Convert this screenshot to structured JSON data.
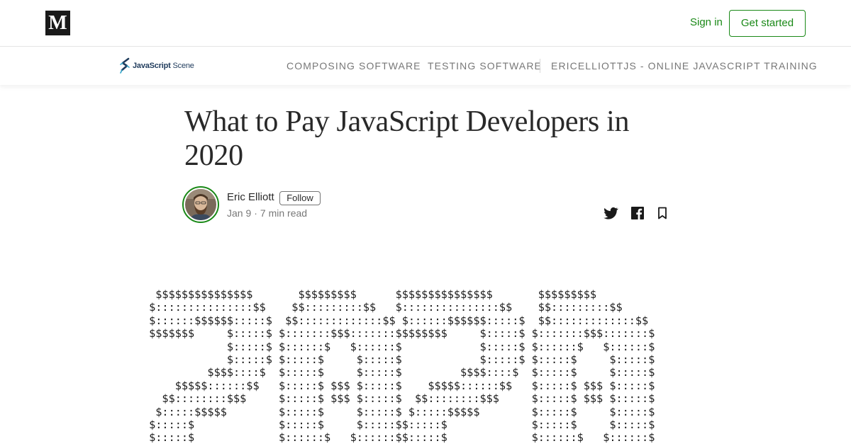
{
  "topbar": {
    "logo_letter": "M",
    "signin_label": "Sign in",
    "get_started_label": "Get started"
  },
  "publication": {
    "logo_word_bold": "JavaScript",
    "logo_word_light": "Scene",
    "nav": [
      "COMPOSING SOFTWARE",
      "TESTING SOFTWARE",
      "ERICELLIOTTJS - ONLINE JAVASCRIPT TRAINING"
    ]
  },
  "article": {
    "title_line1": "What to Pay JavaScript Developers in",
    "title_line2": "2020",
    "author_name": "Eric Elliott",
    "follow_label": "Follow",
    "date": "Jan 9",
    "read_time": "7 min read",
    "ascii_art": "  $$$$$$$$$$$$$$$       $$$$$$$$$      $$$$$$$$$$$$$$$       $$$$$$$$$\n $:::::::::::::::$$    $$:::::::::$$   $:::::::::::::::$$    $$:::::::::$$\n $::::::$$$$$$:::::$  $$:::::::::::::$$ $::::::$$$$$$:::::$  $$:::::::::::::$$\n $$$$$$$     $:::::$ $:::::::$$$:::::::$$$$$$$$     $:::::$ $:::::::$$$:::::::$\n             $:::::$ $::::::$   $::::::$            $:::::$ $::::::$   $::::::$\n             $:::::$ $:::::$     $:::::$            $:::::$ $:::::$     $:::::$\n          $$$$::::$  $:::::$     $:::::$         $$$$::::$  $:::::$     $:::::$\n     $$$$$::::::$$   $:::::$ $$$ $:::::$    $$$$$::::::$$   $:::::$ $$$ $:::::$\n   $$::::::::$$$     $:::::$ $$$ $:::::$  $$::::::::$$$     $:::::$ $$$ $:::::$\n  $:::::$$$$$        $:::::$     $:::::$ $:::::$$$$$        $:::::$     $:::::$\n $:::::$             $:::::$     $:::::$$:::::$             $:::::$     $:::::$\n $:::::$             $::::::$   $::::::$$:::::$             $::::::$   $::::::$"
  },
  "colors": {
    "accent_green": "#1a8917",
    "logo_bg": "#1a1a1a",
    "pub_blue": "#1f3b5c"
  },
  "icons": {
    "medium_logo": "medium-logo-icon",
    "twitter": "twitter-icon",
    "facebook": "facebook-icon",
    "bookmark": "bookmark-icon",
    "pub_logo": "javascript-scene-logo-icon"
  }
}
